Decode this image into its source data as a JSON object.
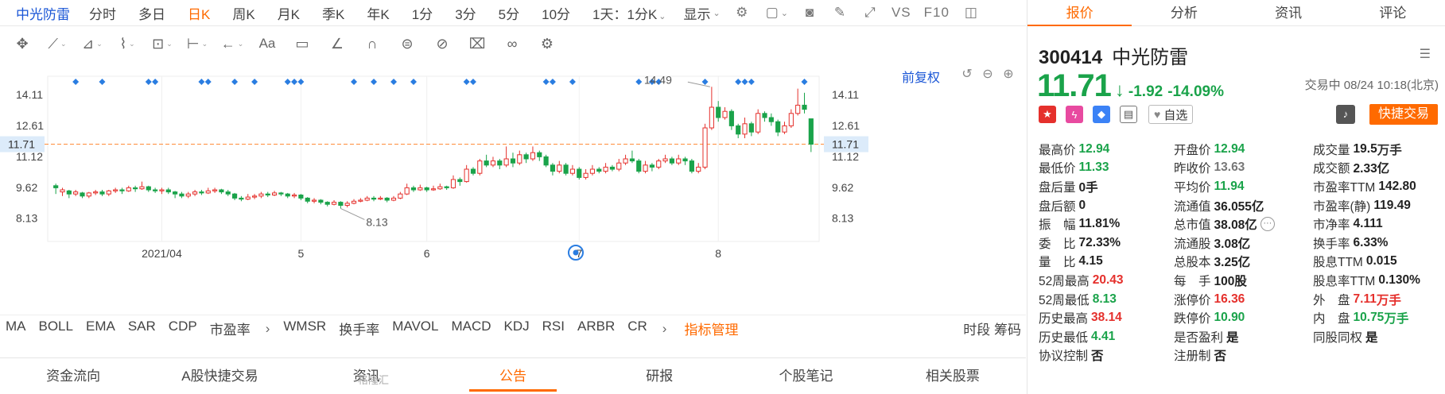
{
  "topbar": {
    "stock_name": "中光防雷",
    "periods": [
      "分时",
      "多日",
      "日K",
      "周K",
      "月K",
      "季K",
      "年K",
      "1分",
      "3分",
      "5分",
      "10分",
      "1天：1分K"
    ],
    "active_period": "日K",
    "display_label": "显示",
    "vs_label": "VS",
    "f10_label": "F10"
  },
  "chart": {
    "adjust_label": "前复权",
    "price_line": "11.71",
    "y_labels": [
      "14.11",
      "12.61",
      "11.71",
      "11.12",
      "9.62",
      "8.13"
    ],
    "x_labels": [
      "2021/04",
      "5",
      "6",
      "7",
      "8"
    ],
    "high_annotation": "14.49",
    "low_annotation": "8.13"
  },
  "chart_data": {
    "type": "candlestick",
    "x_ticks": [
      "2021/04",
      "5",
      "6",
      "7",
      "8"
    ],
    "y_ticks": [
      14.11,
      12.61,
      11.12,
      9.62,
      8.13
    ],
    "ylim": [
      7.0,
      15.0
    ],
    "last_price": 11.71,
    "max_label": 14.49,
    "min_label": 8.13,
    "ohlc": [
      [
        9.7,
        9.6,
        9.8,
        9.3
      ],
      [
        9.4,
        9.5,
        9.6,
        9.2
      ],
      [
        9.45,
        9.3,
        9.5,
        9.1
      ],
      [
        9.3,
        9.4,
        9.5,
        9.2
      ],
      [
        9.35,
        9.2,
        9.4,
        9.1
      ],
      [
        9.2,
        9.35,
        9.4,
        9.1
      ],
      [
        9.35,
        9.4,
        9.5,
        9.25
      ],
      [
        9.4,
        9.3,
        9.5,
        9.2
      ],
      [
        9.3,
        9.45,
        9.5,
        9.2
      ],
      [
        9.45,
        9.5,
        9.6,
        9.35
      ],
      [
        9.5,
        9.45,
        9.6,
        9.3
      ],
      [
        9.45,
        9.6,
        9.7,
        9.4
      ],
      [
        9.6,
        9.55,
        9.7,
        9.4
      ],
      [
        9.55,
        9.65,
        9.9,
        9.5
      ],
      [
        9.65,
        9.5,
        9.7,
        9.4
      ],
      [
        9.5,
        9.45,
        9.6,
        9.35
      ],
      [
        9.45,
        9.5,
        9.6,
        9.3
      ],
      [
        9.5,
        9.4,
        9.6,
        9.3
      ],
      [
        9.4,
        9.3,
        9.45,
        9.1
      ],
      [
        9.3,
        9.2,
        9.4,
        9.1
      ],
      [
        9.2,
        9.3,
        9.4,
        9.1
      ],
      [
        9.3,
        9.4,
        9.5,
        9.2
      ],
      [
        9.4,
        9.35,
        9.5,
        9.25
      ],
      [
        9.35,
        9.45,
        9.6,
        9.3
      ],
      [
        9.45,
        9.5,
        9.6,
        9.35
      ],
      [
        9.5,
        9.4,
        9.55,
        9.3
      ],
      [
        9.4,
        9.3,
        9.5,
        9.2
      ],
      [
        9.3,
        9.1,
        9.35,
        9.0
      ],
      [
        9.1,
        9.05,
        9.2,
        8.95
      ],
      [
        9.05,
        9.15,
        9.3,
        9.0
      ],
      [
        9.15,
        9.2,
        9.3,
        9.05
      ],
      [
        9.2,
        9.3,
        9.4,
        9.1
      ],
      [
        9.3,
        9.25,
        9.4,
        9.15
      ],
      [
        9.25,
        9.35,
        9.45,
        9.2
      ],
      [
        9.35,
        9.3,
        9.4,
        9.2
      ],
      [
        9.3,
        9.2,
        9.35,
        9.1
      ],
      [
        9.2,
        9.25,
        9.35,
        9.1
      ],
      [
        9.25,
        9.1,
        9.3,
        9.0
      ],
      [
        9.1,
        8.95,
        9.15,
        8.85
      ],
      [
        8.95,
        9.0,
        9.1,
        8.85
      ],
      [
        9.0,
        8.9,
        9.05,
        8.8
      ],
      [
        8.9,
        8.8,
        8.95,
        8.7
      ],
      [
        8.8,
        8.9,
        9.0,
        8.75
      ],
      [
        8.9,
        8.75,
        8.95,
        8.6
      ],
      [
        8.75,
        8.85,
        8.95,
        8.65
      ],
      [
        8.85,
        8.95,
        9.05,
        8.8
      ],
      [
        8.95,
        9.0,
        9.1,
        8.9
      ],
      [
        9.0,
        9.1,
        9.2,
        8.95
      ],
      [
        9.1,
        9.05,
        9.2,
        8.95
      ],
      [
        9.05,
        9.1,
        9.2,
        9.0
      ],
      [
        9.1,
        9.0,
        9.15,
        8.9
      ],
      [
        9.0,
        9.1,
        9.2,
        8.95
      ],
      [
        9.1,
        9.3,
        9.4,
        9.05
      ],
      [
        9.3,
        9.6,
        9.8,
        9.25
      ],
      [
        9.6,
        9.5,
        9.7,
        9.4
      ],
      [
        9.5,
        9.6,
        9.75,
        9.45
      ],
      [
        9.6,
        9.5,
        9.65,
        9.4
      ],
      [
        9.5,
        9.55,
        9.7,
        9.45
      ],
      [
        9.55,
        9.65,
        9.8,
        9.5
      ],
      [
        9.65,
        9.6,
        9.7,
        9.5
      ],
      [
        9.6,
        10.0,
        10.2,
        9.55
      ],
      [
        10.0,
        9.9,
        10.1,
        9.7
      ],
      [
        9.9,
        10.5,
        10.7,
        9.85
      ],
      [
        10.5,
        10.3,
        10.6,
        10.2
      ],
      [
        10.3,
        10.9,
        11.0,
        10.2
      ],
      [
        10.9,
        10.7,
        11.2,
        10.6
      ],
      [
        10.7,
        10.9,
        11.1,
        10.6
      ],
      [
        10.9,
        10.7,
        11.0,
        10.5
      ],
      [
        10.7,
        11.0,
        11.6,
        10.6
      ],
      [
        11.0,
        10.8,
        11.3,
        10.6
      ],
      [
        10.8,
        11.2,
        11.4,
        10.7
      ],
      [
        11.2,
        11.0,
        11.3,
        10.8
      ],
      [
        11.0,
        11.3,
        11.6,
        10.9
      ],
      [
        11.3,
        11.1,
        11.4,
        10.9
      ],
      [
        11.1,
        10.7,
        11.2,
        10.6
      ],
      [
        10.7,
        10.4,
        10.8,
        10.2
      ],
      [
        10.4,
        10.7,
        10.9,
        10.3
      ],
      [
        10.7,
        10.3,
        10.8,
        10.2
      ],
      [
        10.3,
        10.5,
        10.7,
        10.2
      ],
      [
        10.5,
        10.1,
        10.6,
        10.0
      ],
      [
        10.1,
        10.3,
        10.5,
        10.0
      ],
      [
        10.3,
        10.5,
        10.7,
        10.2
      ],
      [
        10.5,
        10.4,
        10.6,
        10.3
      ],
      [
        10.4,
        10.6,
        10.8,
        10.3
      ],
      [
        10.6,
        10.5,
        10.7,
        10.4
      ],
      [
        10.5,
        10.8,
        11.0,
        10.4
      ],
      [
        10.8,
        11.0,
        11.2,
        10.7
      ],
      [
        11.0,
        10.9,
        11.4,
        10.8
      ],
      [
        10.9,
        10.4,
        11.0,
        10.3
      ],
      [
        10.4,
        10.7,
        10.9,
        10.3
      ],
      [
        10.7,
        10.6,
        10.8,
        10.4
      ],
      [
        10.6,
        10.9,
        11.0,
        10.5
      ],
      [
        10.9,
        11.0,
        11.2,
        10.8
      ],
      [
        11.0,
        10.8,
        11.1,
        10.7
      ],
      [
        10.8,
        11.0,
        11.2,
        10.7
      ],
      [
        11.0,
        10.9,
        11.1,
        10.7
      ],
      [
        10.9,
        10.4,
        11.0,
        10.3
      ],
      [
        10.4,
        10.6,
        10.8,
        10.3
      ],
      [
        10.6,
        12.5,
        12.7,
        10.5
      ],
      [
        12.5,
        13.5,
        14.49,
        12.4
      ],
      [
        13.5,
        13.0,
        13.8,
        12.8
      ],
      [
        13.0,
        13.3,
        13.5,
        12.9
      ],
      [
        13.3,
        12.6,
        13.4,
        12.4
      ],
      [
        12.6,
        12.2,
        12.7,
        12.0
      ],
      [
        12.2,
        12.7,
        13.0,
        12.0
      ],
      [
        12.7,
        12.3,
        12.8,
        12.1
      ],
      [
        12.3,
        13.2,
        13.4,
        12.2
      ],
      [
        13.2,
        13.0,
        13.3,
        12.8
      ],
      [
        13.0,
        12.8,
        13.2,
        12.6
      ],
      [
        12.8,
        12.3,
        12.9,
        12.1
      ],
      [
        12.3,
        12.6,
        12.8,
        12.2
      ],
      [
        12.6,
        13.2,
        13.4,
        12.5
      ],
      [
        13.2,
        13.6,
        14.4,
        13.1
      ],
      [
        13.6,
        13.4,
        14.2,
        13.2
      ],
      [
        12.94,
        11.71,
        12.94,
        11.33
      ]
    ]
  },
  "drawbar": {
    "tools": [
      "move-tool",
      "line-tool",
      "channel-tool",
      "wave-tool",
      "fibonacci-tool",
      "measure-tool",
      "arrow-tool",
      "text-tool",
      "comment-tool",
      "angle-tool",
      "magnet-tool",
      "eye-tool",
      "hide-tool",
      "delete-tool",
      "link-tool",
      "settings-tool"
    ],
    "text_label": "Aa"
  },
  "indicators": {
    "items": [
      "MA",
      "BOLL",
      "EMA",
      "SAR",
      "CDP",
      "市盈率"
    ],
    "items2": [
      "WMSR",
      "换手率",
      "MAVOL",
      "MACD",
      "KDJ",
      "RSI",
      "ARBR",
      "CR"
    ],
    "manage_label": "指标管理",
    "right_labels": "时段 筹码"
  },
  "bottom_tabs": {
    "items": [
      "资金流向",
      "A股快捷交易",
      "资讯",
      "公告",
      "研报",
      "个股笔记",
      "相关股票"
    ],
    "active": "公告"
  },
  "right_tabs": {
    "items": [
      "报价",
      "分析",
      "资讯",
      "评论"
    ],
    "active": "报价"
  },
  "quote": {
    "code": "300414",
    "name": "中光防雷",
    "price": "11.71",
    "change": "-1.92",
    "change_pct": "-14.09%",
    "status": "交易中 08/24 10:18(北京)",
    "watch_label": "自选",
    "quick_trade_label": "快捷交易",
    "colors": {
      "up": "#e5302c",
      "down": "#1aa34a",
      "accent": "#ff6a00",
      "link": "#1a56d6"
    }
  },
  "fields": [
    [
      {
        "l": "最高价",
        "v": "12.94",
        "c": "green"
      },
      {
        "l": "开盘价",
        "v": "12.94",
        "c": "green"
      },
      {
        "l": "成交量",
        "v": "19.5",
        "u": "万手",
        "c": ""
      }
    ],
    [
      {
        "l": "最低价",
        "v": "11.33",
        "c": "green"
      },
      {
        "l": "昨收价",
        "v": "13.63",
        "c": "gray"
      },
      {
        "l": "成交额",
        "v": "2.33亿",
        "c": ""
      }
    ],
    [
      {
        "l": "盘后量",
        "v": "0手",
        "c": ""
      },
      {
        "l": "平均价",
        "v": "11.94",
        "c": "green"
      },
      {
        "l": "市盈率TTM",
        "v": "142.80",
        "c": ""
      }
    ],
    [
      {
        "l": "盘后额",
        "v": "0",
        "c": ""
      },
      {
        "l": "流通值",
        "v": "36.055亿",
        "c": ""
      },
      {
        "l": "市盈率(静)",
        "v": "119.49",
        "c": ""
      }
    ],
    [
      {
        "l": "振　幅",
        "v": "11.81%",
        "c": ""
      },
      {
        "l": "总市值",
        "v": "38.08亿",
        "c": "",
        "more": true
      },
      {
        "l": "市净率",
        "v": "4.111",
        "c": ""
      }
    ],
    [
      {
        "l": "委　比",
        "v": "72.33%",
        "c": ""
      },
      {
        "l": "流通股",
        "v": "3.08亿",
        "c": ""
      },
      {
        "l": "换手率",
        "v": "6.33%",
        "c": ""
      }
    ],
    [
      {
        "l": "量　比",
        "v": "4.15",
        "c": ""
      },
      {
        "l": "总股本",
        "v": "3.25亿",
        "c": ""
      },
      {
        "l": "股息TTM",
        "v": "0.015",
        "c": ""
      }
    ],
    [
      {
        "l": "52周最高",
        "v": "20.43",
        "c": "red"
      },
      {
        "l": "每　手",
        "v": "100股",
        "c": ""
      },
      {
        "l": "股息率TTM",
        "v": "0.130%",
        "c": ""
      }
    ],
    [
      {
        "l": "52周最低",
        "v": "8.13",
        "c": "green"
      },
      {
        "l": "涨停价",
        "v": "16.36",
        "c": "red"
      },
      {
        "l": "外　盘",
        "v": "7.11",
        "u": "万手",
        "c": "red"
      }
    ],
    [
      {
        "l": "历史最高",
        "v": "38.14",
        "c": "red"
      },
      {
        "l": "跌停价",
        "v": "10.90",
        "c": "green"
      },
      {
        "l": "内　盘",
        "v": "10.75",
        "u": "万手",
        "c": "green"
      }
    ],
    [
      {
        "l": "历史最低",
        "v": "4.41",
        "c": "green"
      },
      {
        "l": "是否盈利",
        "v": "是",
        "c": ""
      },
      {
        "l": "同股同权",
        "v": "是",
        "c": ""
      }
    ],
    [
      {
        "l": "协议控制",
        "v": "否",
        "c": ""
      },
      {
        "l": "注册制",
        "v": "否",
        "c": ""
      },
      {
        "l": "",
        "v": "",
        "c": ""
      }
    ]
  ],
  "watermark": "格隆汇"
}
